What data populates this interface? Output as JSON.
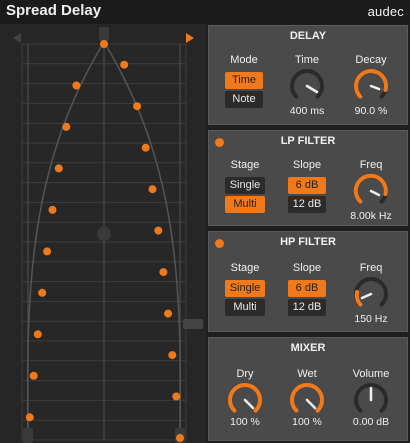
{
  "app": {
    "title": "Spread Delay",
    "brand": "audec"
  },
  "colors": {
    "accent": "#f07a1b",
    "panel": "#4a4a4a",
    "background": "#262626"
  },
  "visualizer": {
    "left_arrow_icon": "triangle-left-icon",
    "right_arrow_icon": "triangle-right-icon",
    "tap_count": 20
  },
  "delay": {
    "title": "DELAY",
    "mode_label": "Mode",
    "mode_options": [
      "Time",
      "Note"
    ],
    "mode_selected": "Time",
    "time_label": "Time",
    "time_value": "400 ms",
    "decay_label": "Decay",
    "decay_value": "90.0 %"
  },
  "lp_filter": {
    "title": "LP FILTER",
    "enabled": true,
    "stage_label": "Stage",
    "stage_options": [
      "Single",
      "Multi"
    ],
    "stage_selected": "Multi",
    "slope_label": "Slope",
    "slope_options": [
      "6 dB",
      "12 dB"
    ],
    "slope_selected": "6 dB",
    "freq_label": "Freq",
    "freq_value": "8.00k Hz"
  },
  "hp_filter": {
    "title": "HP FILTER",
    "enabled": true,
    "stage_label": "Stage",
    "stage_options": [
      "Single",
      "Multi"
    ],
    "stage_selected": "Single",
    "slope_label": "Slope",
    "slope_options": [
      "6 dB",
      "12 dB"
    ],
    "slope_selected": "6 dB",
    "freq_label": "Freq",
    "freq_value": "150 Hz"
  },
  "mixer": {
    "title": "MIXER",
    "dry_label": "Dry",
    "dry_value": "100 %",
    "wet_label": "Wet",
    "wet_value": "100 %",
    "volume_label": "Volume",
    "volume_value": "0.00 dB"
  }
}
